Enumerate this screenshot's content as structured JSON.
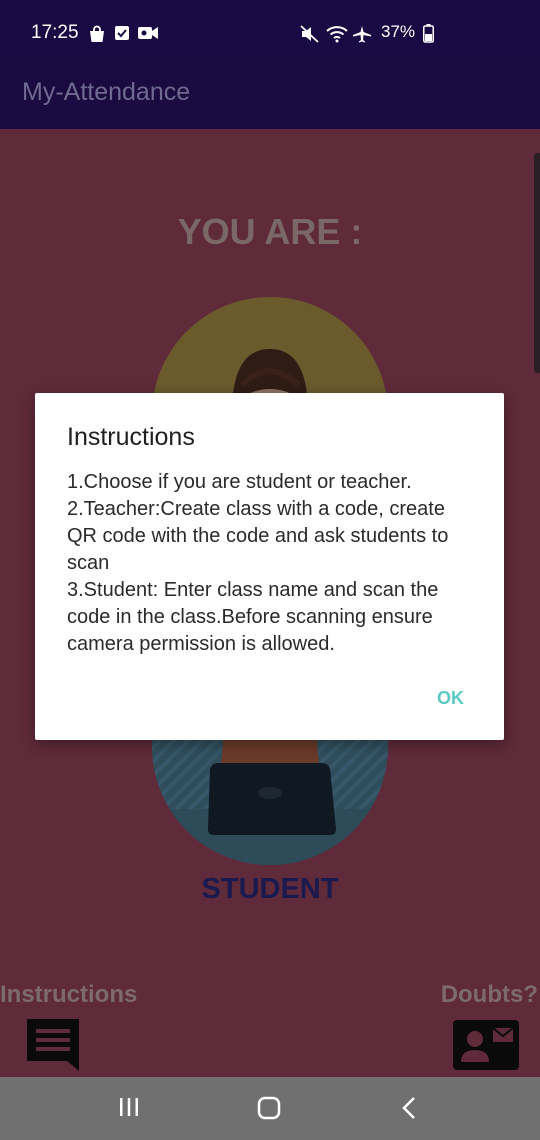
{
  "status_bar": {
    "time": "17:25",
    "battery": "37%",
    "left_icons": [
      "bag-icon",
      "checkbox-icon",
      "video-icon"
    ],
    "right_icons": [
      "mute-icon",
      "wifi-icon",
      "airplane-icon",
      "battery-icon"
    ]
  },
  "app_bar": {
    "title": "My-Attendance",
    "color": "#1b0a3f"
  },
  "main": {
    "heading": "YOU ARE :",
    "student_label": "STUDENT",
    "instructions_label": "Instructions",
    "doubts_label": "Doubts?",
    "background": "#5f2a3a"
  },
  "dialog": {
    "title": "Instructions",
    "body": "1.Choose if you are student or teacher.\n2.Teacher:Create class with a code, create QR code with the code and ask students to scan\n3.Student: Enter class name and scan the code in the class.Before scanning ensure camera permission is allowed.",
    "ok_label": "OK",
    "accent": "#59c9c4"
  },
  "nav_bar": {
    "buttons": [
      "recent-apps-icon",
      "home-icon",
      "back-icon"
    ]
  }
}
